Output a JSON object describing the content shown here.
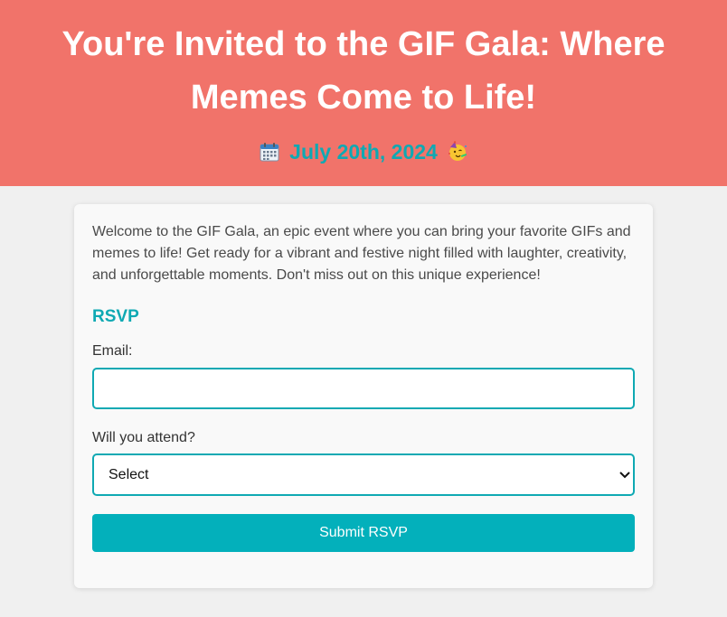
{
  "header": {
    "title": "You're Invited to the GIF Gala: Where Memes Come to Life!",
    "date": "July 20th, 2024",
    "icons": {
      "leading": "calendar-icon",
      "trailing": "partying-face-icon"
    }
  },
  "card": {
    "intro": "Welcome to the GIF Gala, an epic event where you can bring your favorite GIFs and memes to life! Get ready for a vibrant and festive night filled with laughter, creativity, and unforgettable moments. Don't miss out on this unique experience!",
    "rsvp_title": "RSVP",
    "email_label": "Email:",
    "email_value": "",
    "attend_label": "Will you attend?",
    "attend_selected": "Select",
    "submit_label": "Submit RSVP"
  },
  "colors": {
    "header_bg": "#f1736a",
    "accent": "#0fa9b3",
    "button": "#03b0bb",
    "page_bg": "#f0f0f0"
  }
}
